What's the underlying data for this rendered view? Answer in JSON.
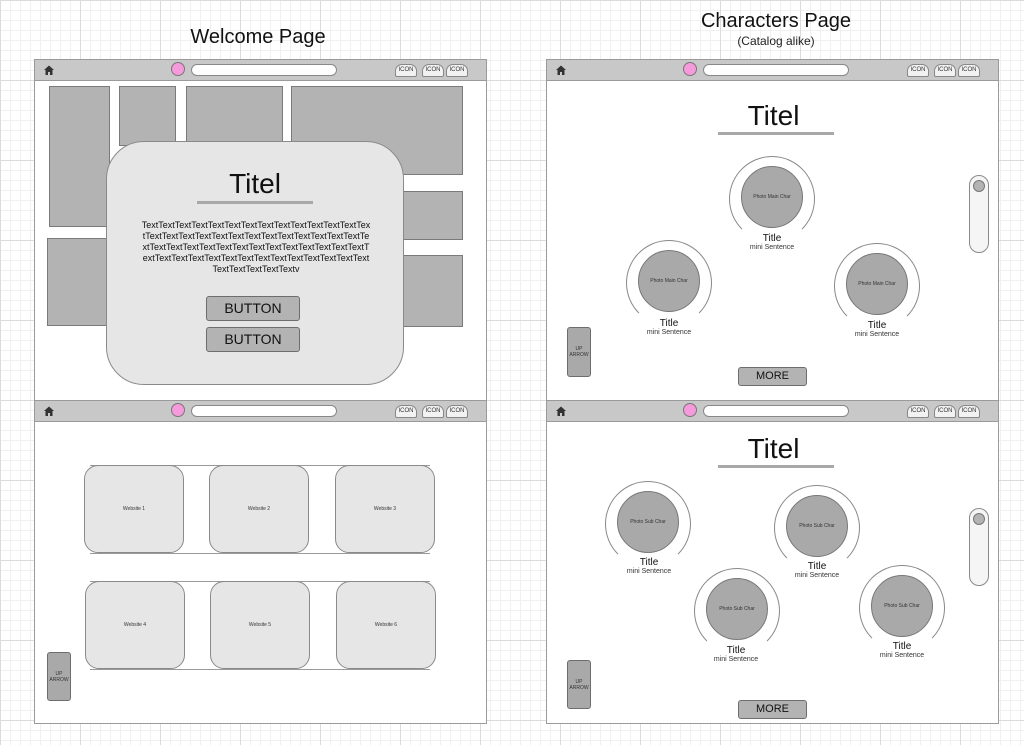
{
  "headings": {
    "welcome": "Welcome Page",
    "characters": "Characters Page",
    "characters_sub": "(Catalog alike)"
  },
  "browser": {
    "icon_label": "ICON",
    "home_icon": "home-icon",
    "record_color": "#f59bdc"
  },
  "welcome": {
    "title": "Titel",
    "text": "TextTextTextTextTextTextTextTextTextTextTextTextTextTextTextTextTextTextTextTextTextTextTextTextTextTextTextTextTextTextTextTextTextTextTextTextTextTextTextTextTextTextTextTextTextTextTextTextTextTextTextTextTextTextTextTextTextTextTextTextv",
    "button1": "BUTTON",
    "button2": "BUTTON"
  },
  "websites": {
    "items": [
      "Website 1",
      "Website 2",
      "Website 3",
      "Website 4",
      "Website 5",
      "Website 6"
    ],
    "up_arrow": "UP ARROW"
  },
  "characters_main": {
    "title": "Titel",
    "items": [
      {
        "photo": "Photo Main Char",
        "title": "Title",
        "subtitle": "mini Sentence"
      },
      {
        "photo": "Photo Main Char",
        "title": "Title",
        "subtitle": "mini Sentence"
      },
      {
        "photo": "Photo Main Char",
        "title": "Title",
        "subtitle": "mini Sentence"
      }
    ],
    "more": "MORE",
    "up_arrow": "UP ARROW"
  },
  "characters_sub": {
    "title": "Titel",
    "items": [
      {
        "photo": "Photo Sub Char",
        "title": "Title",
        "subtitle": "mini Sentence"
      },
      {
        "photo": "Photo Sub Char",
        "title": "Title",
        "subtitle": "mini Sentence"
      },
      {
        "photo": "Photo Sub Char",
        "title": "Title",
        "subtitle": "mini Sentence"
      },
      {
        "photo": "Photo Sub Char",
        "title": "Title",
        "subtitle": "mini Sentence"
      }
    ],
    "more": "MORE",
    "up_arrow": "UP ARROW"
  }
}
